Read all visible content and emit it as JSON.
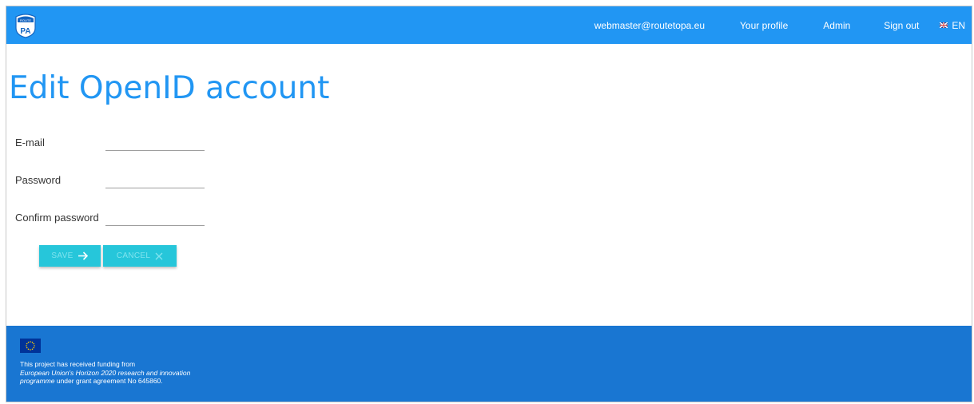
{
  "header": {
    "logo_alt": "ROUTE TO PA",
    "nav": {
      "email": "webmaster@routetopa.eu",
      "profile": "Your profile",
      "admin": "Admin",
      "signout": "Sign out",
      "language": "EN"
    }
  },
  "main": {
    "title": "Edit OpenID account",
    "fields": [
      {
        "label": "E-mail",
        "value": ""
      },
      {
        "label": "Password",
        "value": ""
      },
      {
        "label": "Confirm password",
        "value": ""
      }
    ],
    "buttons": {
      "save": "SAVE",
      "cancel": "CANCEL"
    }
  },
  "footer": {
    "line1": "This project has received funding from",
    "line2_italic": "European Union's Horizon 2020 research and innovation programme",
    "line3": "under grant agreement No 645860."
  },
  "colors": {
    "header_bg": "#2196f3",
    "footer_bg": "#1976d2",
    "title": "#2196f3",
    "button_bg": "#26c6da"
  }
}
